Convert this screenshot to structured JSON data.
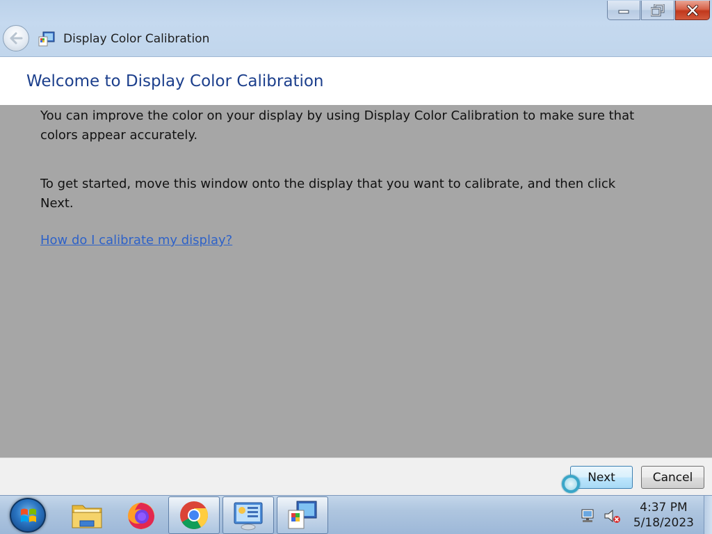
{
  "window": {
    "title": "Display Color Calibration",
    "heading": "Welcome to Display Color Calibration"
  },
  "content": {
    "paragraph1": "You can improve the color on your display by using Display Color Calibration to make sure that colors appear accurately.",
    "paragraph2": "To get started, move this window onto the display that you want to calibrate, and then click Next.",
    "help_link": "How do I calibrate my display?"
  },
  "buttons": {
    "next": "Next",
    "cancel": "Cancel"
  },
  "taskbar": {
    "pinned": [
      "file-explorer-icon",
      "firefox-icon",
      "chrome-icon",
      "control-panel-icon",
      "display-color-calibration-icon"
    ],
    "active_items": [
      "chrome-icon",
      "control-panel-icon",
      "display-color-calibration-icon"
    ],
    "clock_time": "4:37 PM",
    "clock_date": "5/18/2023"
  },
  "colors": {
    "heading": "#1c3f8c",
    "link": "#2e62c8",
    "content_bg": "#a6a6a6",
    "close_button": "#c1381c"
  }
}
